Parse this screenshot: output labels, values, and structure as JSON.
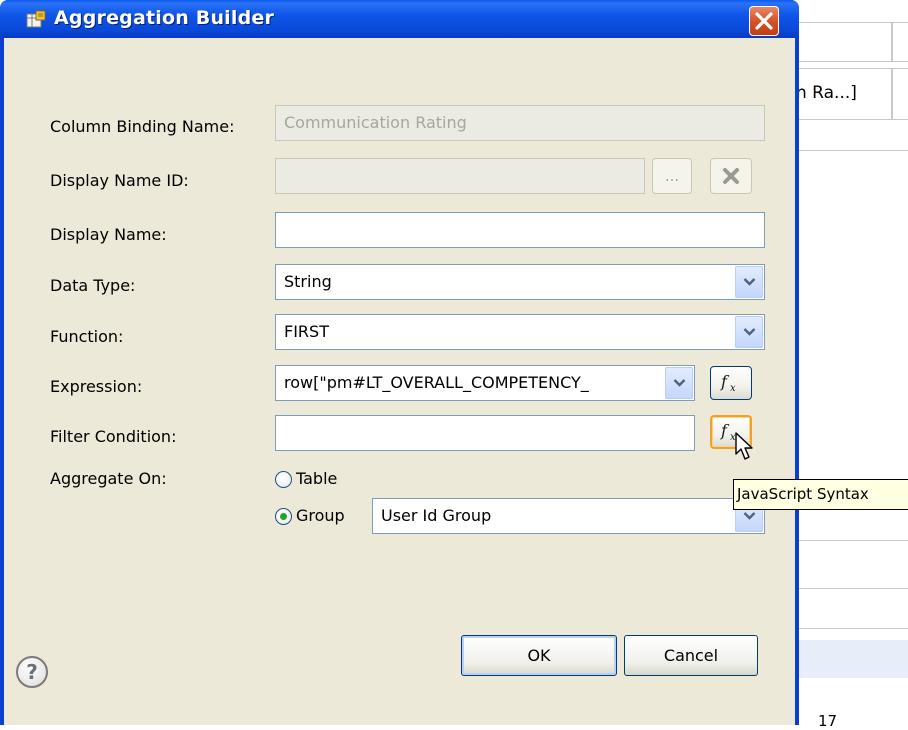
{
  "dialog": {
    "title": "Aggregation Builder",
    "close_icon": "close-icon"
  },
  "form": {
    "column_binding_name": {
      "label": "Column Binding Name:",
      "value": "Communication Rating"
    },
    "display_name_id": {
      "label": "Display Name ID:",
      "value": "",
      "browse_label": "...",
      "clear_icon": "x-icon"
    },
    "display_name": {
      "label": "Display Name:",
      "value": ""
    },
    "data_type": {
      "label": "Data Type:",
      "value": "String"
    },
    "function": {
      "label": "Function:",
      "value": "FIRST"
    },
    "expression": {
      "label": "Expression:",
      "value": "row[\"pm#LT_OVERALL_COMPETENCY_"
    },
    "filter_condition": {
      "label": "Filter Condition:",
      "value": ""
    },
    "aggregate_on": {
      "label": "Aggregate On:",
      "table_label": "Table",
      "group_label": "Group",
      "selected": "group",
      "group_value": "User Id Group"
    }
  },
  "buttons": {
    "ok": "OK",
    "cancel": "Cancel",
    "help": "?"
  },
  "tooltip": {
    "text": "JavaScript Syntax"
  },
  "background": {
    "cell_text": "n Ra...]",
    "bottom_text": "17"
  },
  "colors": {
    "titlebar": "#0a49d8",
    "dialog_bg": "#ece9d8",
    "close_red": "#d5532a",
    "tooltip_bg": "#ffffe1"
  }
}
